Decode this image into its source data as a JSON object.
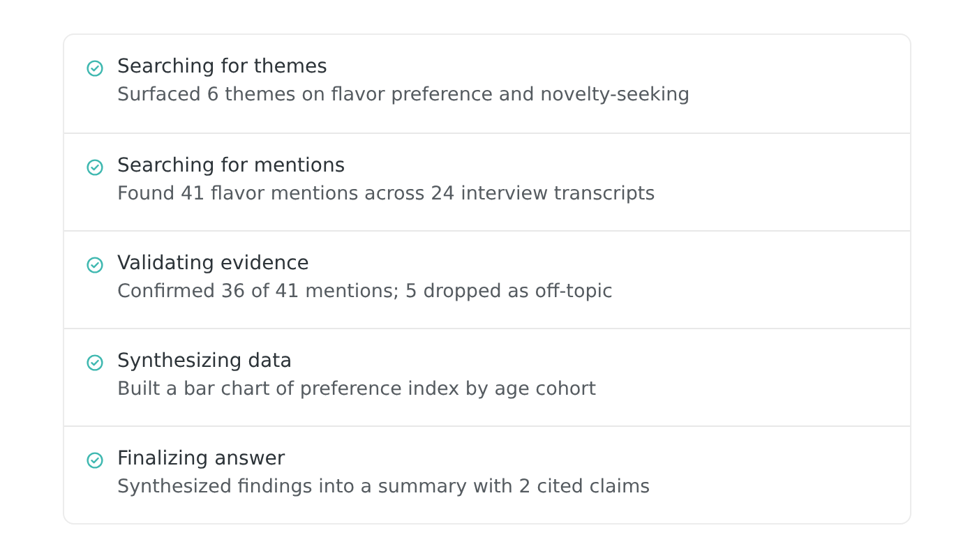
{
  "steps": [
    {
      "title": "Searching for themes",
      "detail": "Surfaced 6 themes on flavor preference and novelty-seeking",
      "done": true
    },
    {
      "title": "Searching for mentions",
      "detail": "Found 41 flavor mentions across 24 interview transcripts",
      "done": true
    },
    {
      "title": "Validating evidence",
      "detail": "Confirmed 36 of 41 mentions; 5 dropped as off-topic",
      "done": true
    },
    {
      "title": "Synthesizing data",
      "detail": "Built a bar chart of preference index by age cohort",
      "done": true
    },
    {
      "title": "Finalizing answer",
      "detail": "Synthesized findings into a summary with 2 cited claims",
      "done": true
    }
  ]
}
